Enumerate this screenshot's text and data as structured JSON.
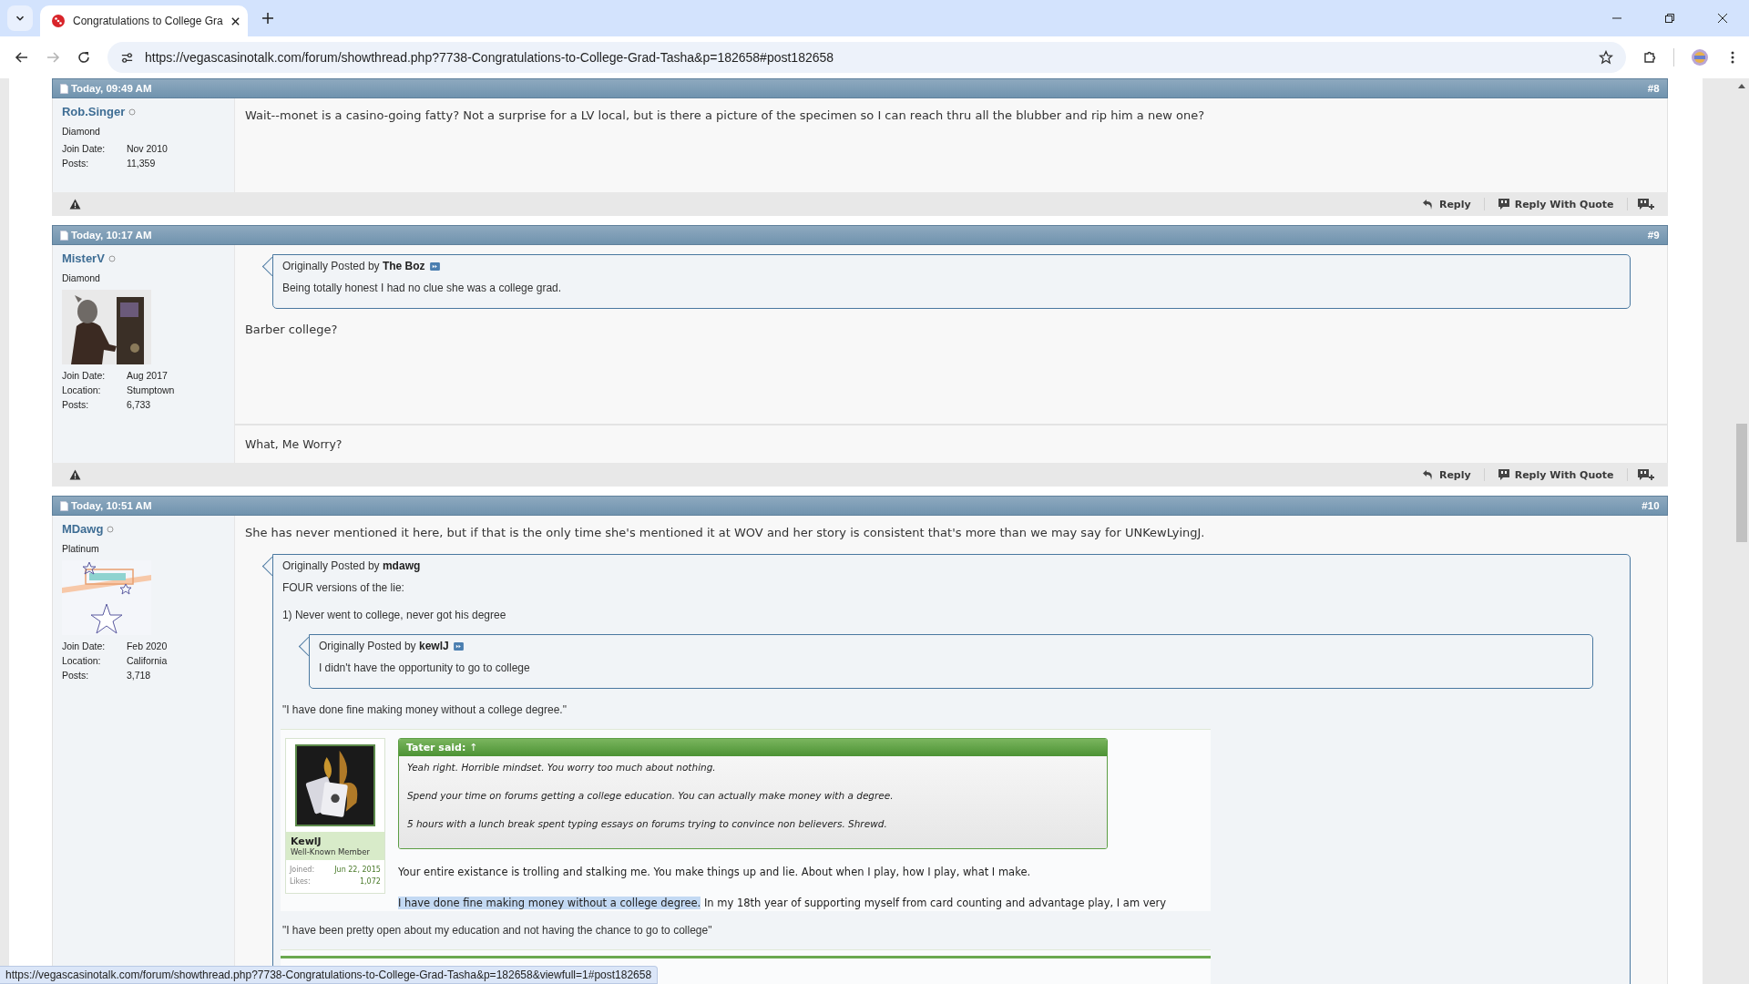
{
  "browser": {
    "tab_title": "Congratulations to College Gra",
    "url": "https://vegascasinotalk.com/forum/showthread.php?7738-Congratulations-to-College-Grad-Tasha&p=182658#post182658",
    "forward_disabled": true,
    "status_url": "https://vegascasinotalk.com/forum/showthread.php?7738-Congratulations-to-College-Grad-Tasha&p=182658&viewfull=1#post182658"
  },
  "posts": [
    {
      "date": "Today, 09:49 AM",
      "number": "#8",
      "user": {
        "name": "Rob.Singer",
        "online": false,
        "rank": "Diamond",
        "fields": [
          {
            "label": "Join Date:",
            "value": "Nov 2010"
          },
          {
            "label": "Posts:",
            "value": "11,359"
          }
        ]
      },
      "content": [
        {
          "kind": "text",
          "text": "Wait--monet is a casino-going fatty? Not a surprise for a LV local, but is there a picture of the specimen so I can reach thru all the blubber and rip him a new one?"
        }
      ],
      "actions": [
        "Reply",
        "Reply With Quote"
      ]
    },
    {
      "date": "Today, 10:17 AM",
      "number": "#9",
      "user": {
        "name": "MisterV",
        "online": false,
        "rank": "Diamond",
        "fields": [
          {
            "label": "Join Date:",
            "value": "Aug 2017"
          },
          {
            "label": "Location:",
            "value": "Stumptown"
          },
          {
            "label": "Posts:",
            "value": "6,733"
          }
        ]
      },
      "content": [
        {
          "kind": "quote",
          "prefix": "Originally Posted by",
          "author": "The Boz",
          "link": true,
          "body": [
            {
              "kind": "text",
              "text": "Being totally honest I had no clue she was a college grad."
            }
          ]
        },
        {
          "kind": "text",
          "text": "Barber college?"
        }
      ],
      "signature": "What, Me Worry?",
      "actions": [
        "Reply",
        "Reply With Quote"
      ]
    },
    {
      "date": "Today, 10:51 AM",
      "number": "#10",
      "user": {
        "name": "MDawg",
        "online": false,
        "rank": "Platinum",
        "fields": [
          {
            "label": "Join Date:",
            "value": "Feb 2020"
          },
          {
            "label": "Location:",
            "value": "California"
          },
          {
            "label": "Posts:",
            "value": "3,718"
          }
        ]
      },
      "content": [
        {
          "kind": "text",
          "text": "She has never mentioned it here, but if that is the only time she's mentioned it at WOV and her story is consistent that's more than we may say for UNKewLyingJ."
        },
        {
          "kind": "quote",
          "prefix": "Originally Posted by",
          "author": "mdawg",
          "link": false,
          "body": [
            {
              "kind": "text",
              "text": "FOUR versions of the lie:"
            },
            {
              "kind": "text",
              "text": "1) Never went to college, never got his degree"
            },
            {
              "kind": "quote",
              "prefix": "Originally Posted by",
              "author": "kewlJ",
              "link": true,
              "body": [
                {
                  "kind": "text",
                  "text": "I didn't have the opportunity to go to college"
                }
              ]
            },
            {
              "kind": "text",
              "text": "\"I have done fine making money without a college degree.\""
            },
            {
              "kind": "screenshot",
              "user": {
                "name": "KewlJ",
                "title": "Well-Known Member",
                "stats": [
                  {
                    "label": "Joined:",
                    "value": "Jun 22, 2015"
                  },
                  {
                    "label": "Likes:",
                    "value": "1,072"
                  }
                ]
              },
              "quote": {
                "author": "Tater said:",
                "jump": "↑",
                "lines": [
                  "Yeah right. Horrible mindset. You worry too much about nothing.",
                  "Spend your time on forums getting a college education. You can actually make money with a degree.",
                  "5 hours with a lunch break spent typing essays on forums trying to convince non believers. Shrewd."
                ]
              },
              "paragraphs": [
                {
                  "text": "Your entire existance is trolling and stalking me. You make things up and lie. About when I play, how I play, what I make."
                },
                {
                  "highlighted": "I have done fine making money without a college degree.",
                  "text": " In my 18th year of supporting myself from card counting and advantage play, I am very"
                }
              ]
            },
            {
              "kind": "text",
              "text": "\"I have been pretty open about my education and not having the chance to go to college\""
            },
            {
              "kind": "screenshot_edge"
            }
          ]
        }
      ]
    }
  ]
}
